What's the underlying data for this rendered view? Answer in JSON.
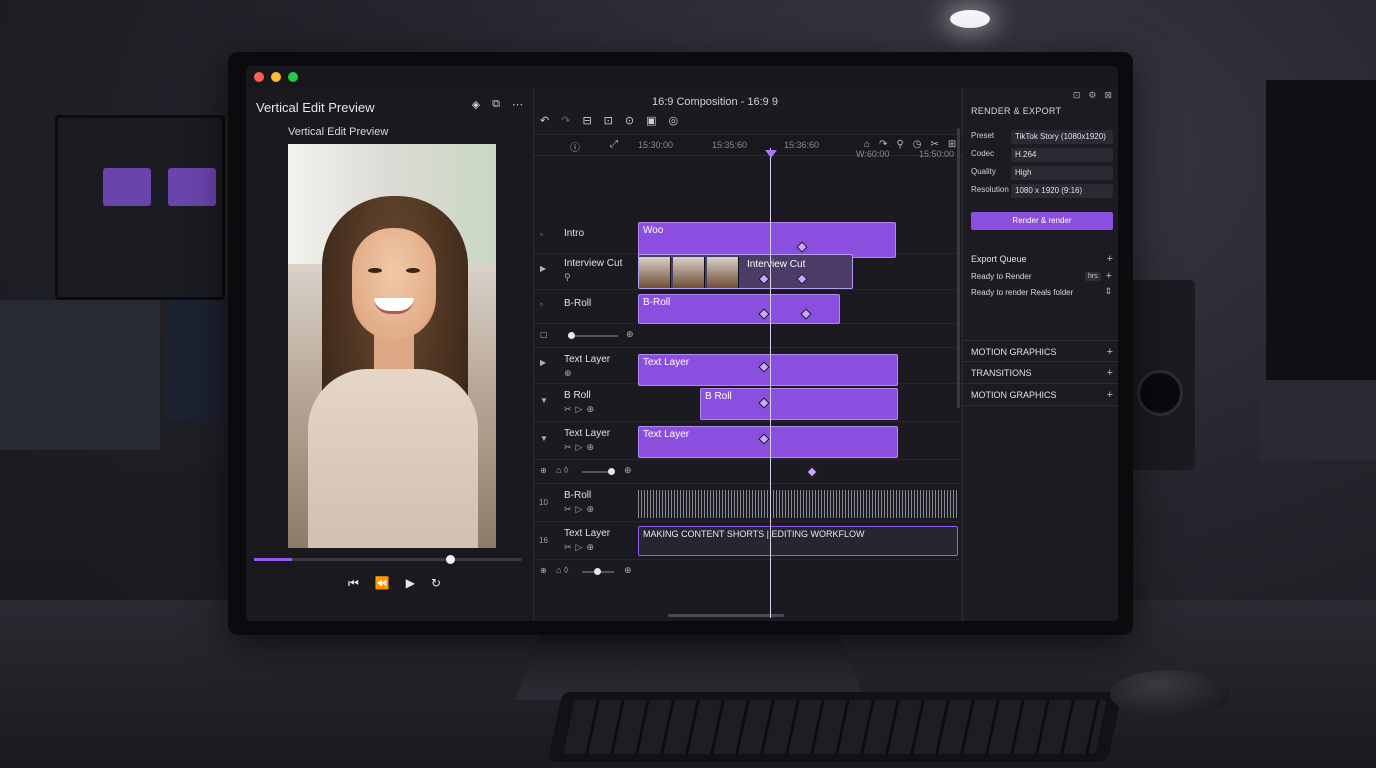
{
  "window": {
    "title": "Vertical Edit Preview",
    "colors": {
      "close": "#ff5f57",
      "minimize": "#febc2e",
      "maximize": "#28c840",
      "accent": "#8b4fe0"
    }
  },
  "preview": {
    "subtitle": "Vertical Edit Preview",
    "icons": [
      "diamond-icon",
      "share-icon",
      "more-icon"
    ],
    "progress": 0.14,
    "playhead_position": 0.73,
    "transport": [
      "⏮",
      "⏪",
      "▶",
      "↻"
    ]
  },
  "timeline": {
    "composition_title": "16:9 Composition - 16:9 9",
    "ruler": [
      "15:30:00",
      "15:35:60",
      "15:36:60",
      "W:60:00",
      "15:50:00"
    ],
    "tracks": [
      {
        "label": "Intro",
        "clip": "Woo"
      },
      {
        "label": "Interview Cut",
        "clip": "Interview Cut"
      },
      {
        "label": "B-Roll",
        "clip": "B-Roll"
      },
      {
        "label": "Text Layer",
        "clip": "Text Layer"
      },
      {
        "label": "B-Roll",
        "clip": "B Roll"
      },
      {
        "label": "Text Layer",
        "clip": "Text Layer"
      },
      {
        "label": "B-Roll",
        "number": "10"
      },
      {
        "label": "Text Layer",
        "number": "16",
        "clip": "MAKING CONTENT SHORTS | EDITING WORKFLOW"
      }
    ],
    "track_labels_shown": [
      "Intro",
      "Interview Cut",
      "B-Roll",
      "Text Layer",
      "B Roll",
      "Text Layer",
      "B-Roll",
      "Text Layer"
    ]
  },
  "render": {
    "title": "RENDER & EXPORT",
    "fields": [
      {
        "label": "Preset",
        "value": "TikTok Story (1080x1920)"
      },
      {
        "label": "Codec",
        "value": "H.264"
      },
      {
        "label": "Quality",
        "value": "High"
      },
      {
        "label": "Resolution",
        "value": "1080 x 1920 (9:16)"
      }
    ],
    "render_button": "Render & render",
    "export_queue": "Export Queue",
    "ready": "Ready to Render",
    "ready_tag": "hrs",
    "ready_detail": "Ready to render Reals folder",
    "sections": [
      "MOTION GRAPHICS",
      "TRANSITIONS",
      "MOTION GRAPHICS"
    ]
  }
}
